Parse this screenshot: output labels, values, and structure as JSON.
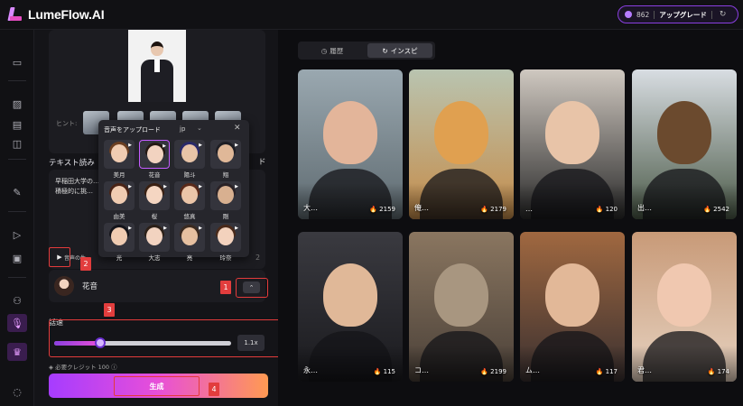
{
  "app": {
    "logo": "LumeFlow.AI"
  },
  "header": {
    "credits": "862",
    "upgrade_label": "アップグレード",
    "refresh_icon": "refresh-icon"
  },
  "rail": {
    "icons": [
      "folder-icon",
      "image-icon",
      "image-edit-icon",
      "layers-icon",
      "photo-edit-icon",
      "video-icon",
      "image-to-video-icon",
      "people-icon",
      "mic-icon",
      "crown-icon",
      "chat-icon"
    ]
  },
  "panel": {
    "hint_label": "ヒント:",
    "section_title": "テキスト読み",
    "section_suffix": "ド",
    "text_content": "早稲田大学の… も積極的に挑…",
    "play_label": "音声の生…",
    "count_right": "2",
    "voice_name": "花音",
    "speed_label": "話速",
    "speed_value": "1.1x",
    "speed_fraction": 0.26,
    "credit_note": "必要クレジット 100",
    "generate_label": "生成"
  },
  "badges": [
    "1",
    "2",
    "3",
    "4"
  ],
  "popup": {
    "title": "音声をアップロード",
    "language": "jp",
    "voices": [
      {
        "name": "美月",
        "hair": "#6b3f22",
        "skin": "#f0ccb2",
        "selected": false
      },
      {
        "name": "花音",
        "hair": "#241812",
        "skin": "#f2d3c0",
        "selected": true
      },
      {
        "name": "陽斗",
        "hair": "#2a2a6a",
        "skin": "#e8c4a8",
        "selected": false
      },
      {
        "name": "翔",
        "hair": "#1e1e24",
        "skin": "#e0b898",
        "selected": false
      },
      {
        "name": "由美",
        "hair": "#4a2416",
        "skin": "#f0ccb2",
        "selected": false
      },
      {
        "name": "桜",
        "hair": "#3a2012",
        "skin": "#f5d6c2",
        "selected": false
      },
      {
        "name": "悠真",
        "hair": "#5a2a1a",
        "skin": "#ebc5a8",
        "selected": false
      },
      {
        "name": "剛",
        "hair": "#2a2226",
        "skin": "#d8b090",
        "selected": false
      },
      {
        "name": "光",
        "hair": "#14141a",
        "skin": "#f0ccb2",
        "selected": false
      },
      {
        "name": "大志",
        "hair": "#2c2018",
        "skin": "#f2d3c0",
        "selected": false
      },
      {
        "name": "亮",
        "hair": "#3a2a20",
        "skin": "#e6c0a0",
        "selected": false
      },
      {
        "name": "玲奈",
        "hair": "#4a2a1a",
        "skin": "#f3d2bd",
        "selected": false
      }
    ]
  },
  "tabs": {
    "history": "履歴",
    "inspire": "インスピ"
  },
  "gallery": [
    {
      "name": "大…",
      "likes": "2159",
      "bg1": "#9aa8b0",
      "bg2": "#5e6a70",
      "fig": "#e3b59a"
    },
    {
      "name": "俺…",
      "likes": "2179",
      "bg1": "#b9c4b0",
      "bg2": "#c58c4a",
      "fig": "#e0a050"
    },
    {
      "name": "…",
      "likes": "120",
      "bg1": "#cfc8c0",
      "bg2": "#2a2a2a",
      "fig": "#e8c4a8"
    },
    {
      "name": "出…",
      "likes": "2542",
      "bg1": "#d8dde2",
      "bg2": "#4b5a48",
      "fig": "#6b4a2e"
    },
    {
      "name": "永…",
      "likes": "115",
      "bg1": "#3a3a40",
      "bg2": "#1a1a1e",
      "fig": "#e0b898"
    },
    {
      "name": "コ…",
      "likes": "2199",
      "bg1": "#8a7660",
      "bg2": "#4a4038",
      "fig": "#a89680"
    },
    {
      "name": "ム…",
      "likes": "117",
      "bg1": "#a06840",
      "bg2": "#3a3030",
      "fig": "#e2b898"
    },
    {
      "name": "君…",
      "likes": "174",
      "bg1": "#c89a78",
      "bg2": "#e6d2c0",
      "fig": "#f0c8b0"
    }
  ]
}
